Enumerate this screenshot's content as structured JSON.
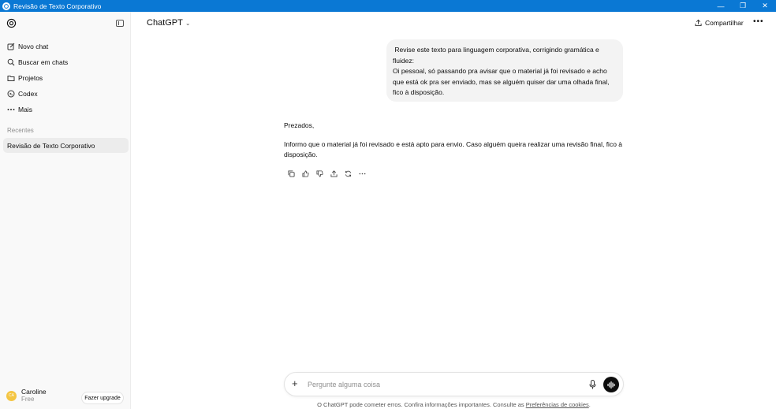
{
  "window": {
    "title": "Revisão de Texto Corporativo"
  },
  "sidebar": {
    "items": [
      {
        "label": "Novo chat",
        "icon": "edit-icon"
      },
      {
        "label": "Buscar em chats",
        "icon": "search-icon"
      },
      {
        "label": "Projetos",
        "icon": "folder-icon"
      },
      {
        "label": "Codex",
        "icon": "codex-icon"
      },
      {
        "label": "Mais",
        "icon": "more-icon"
      }
    ],
    "recent_heading": "Recentes",
    "recent_chats": [
      "Revisão de Texto Corporativo"
    ],
    "user": {
      "name": "Caroline",
      "plan": "Free",
      "initials": "CA"
    },
    "upgrade_label": "Fazer upgrade"
  },
  "header": {
    "model": "ChatGPT",
    "share_label": "Compartilhar"
  },
  "conversation": {
    "user_message": " Revise este texto para linguagem corporativa, corrigindo gramática e fluidez:\nOi pessoal, só passando pra avisar que o material já foi revisado e acho que está ok pra ser enviado, mas se alguém quiser dar uma olhada final, fico à disposição.",
    "assistant_paragraphs": [
      "Prezados,",
      "Informo que o material já foi revisado e está apto para envio. Caso alguém queira realizar uma revisão final, fico à disposição."
    ]
  },
  "composer": {
    "placeholder": "Pergunte alguma coisa"
  },
  "footer": {
    "text": "O ChatGPT pode cometer erros. Confira informações importantes. Consulte as ",
    "link": "Preferências de cookies",
    "end": "."
  },
  "colors": {
    "titlebar": "#0a78d4",
    "sidebar_bg": "#f9f9f9",
    "bubble_bg": "#f3f3f3",
    "avatar": "#f4c542"
  }
}
